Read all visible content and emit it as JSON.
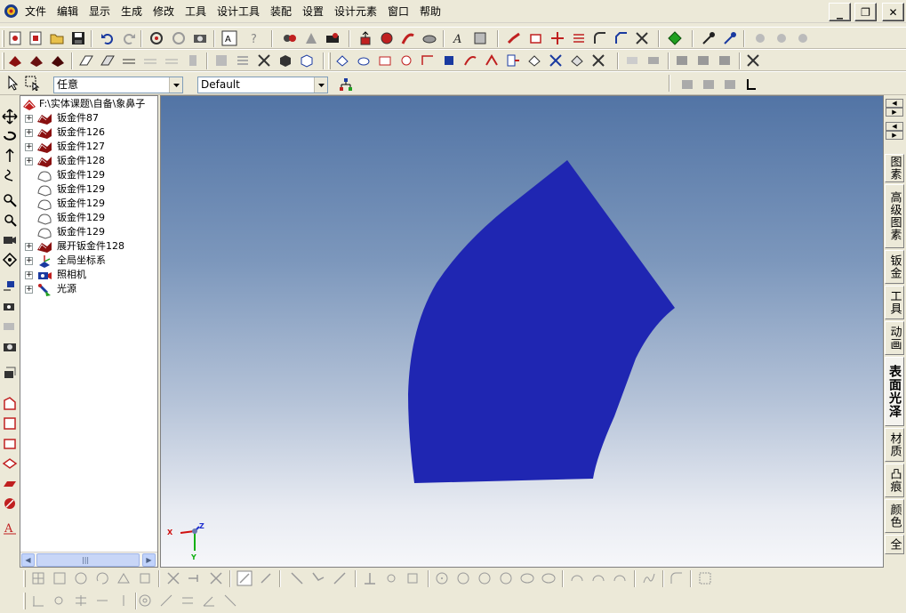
{
  "menu": {
    "items": [
      "文件",
      "编辑",
      "显示",
      "生成",
      "修改",
      "工具",
      "设计工具",
      "装配",
      "设置",
      "设计元素",
      "窗口",
      "帮助"
    ]
  },
  "window_controls": {
    "minimize": "_",
    "restore": "❐",
    "close": "✕"
  },
  "filter_combo": {
    "value": "任意"
  },
  "style_combo": {
    "value": "Default"
  },
  "tree": {
    "root_label": "F:\\实体课题\\自备\\象鼻子",
    "items": [
      {
        "label": "钣金件87",
        "expandable": true,
        "icon": "sheet-metal-solid-icon"
      },
      {
        "label": "钣金件126",
        "expandable": true,
        "icon": "sheet-metal-solid-icon"
      },
      {
        "label": "钣金件127",
        "expandable": true,
        "icon": "sheet-metal-solid-icon"
      },
      {
        "label": "钣金件128",
        "expandable": true,
        "icon": "sheet-metal-solid-icon"
      },
      {
        "label": "钣金件129",
        "expandable": false,
        "icon": "sheet-metal-outline-icon"
      },
      {
        "label": "钣金件129",
        "expandable": false,
        "icon": "sheet-metal-outline-icon"
      },
      {
        "label": "钣金件129",
        "expandable": false,
        "icon": "sheet-metal-outline-icon"
      },
      {
        "label": "钣金件129",
        "expandable": false,
        "icon": "sheet-metal-outline-icon"
      },
      {
        "label": "钣金件129",
        "expandable": false,
        "icon": "sheet-metal-outline-icon"
      },
      {
        "label": "展开钣金件128",
        "expandable": true,
        "icon": "sheet-metal-solid-icon"
      },
      {
        "label": "全局坐标系",
        "expandable": true,
        "icon": "coordinate-system-icon"
      },
      {
        "label": "照相机",
        "expandable": true,
        "icon": "camera-icon"
      },
      {
        "label": "光源",
        "expandable": true,
        "icon": "light-source-icon"
      }
    ],
    "scrollbar_grip": "|||"
  },
  "right_tabs": {
    "nav": [
      "◀",
      "▶",
      "◀",
      "▶"
    ],
    "tabs": [
      "图素",
      "高级图素",
      "钣金",
      "工具",
      "动画",
      "表面光泽",
      "材质",
      "凸痕",
      "颜色",
      "全"
    ],
    "active": "表面光泽"
  },
  "triad": {
    "x_label": "X",
    "y_label": "Y",
    "z_label": "Z"
  },
  "colors": {
    "part_fill": "#1f26b2",
    "viewport_top": "#5274a5",
    "viewport_bottom": "#f6f7fa",
    "triad_x": "#d01010",
    "triad_y": "#10b010",
    "triad_z": "#2030d0"
  }
}
